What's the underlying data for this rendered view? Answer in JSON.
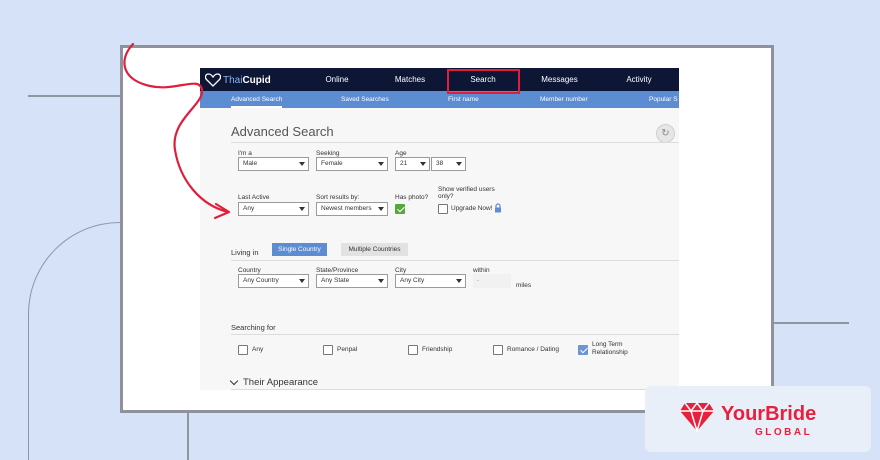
{
  "brand": {
    "logo_part1": "Thai",
    "logo_part2": "Cupid",
    "accent_color": "#5c8cd2",
    "nav_color": "#0d1735"
  },
  "nav": {
    "items": [
      "Online",
      "Matches",
      "Search",
      "Messages",
      "Activity"
    ]
  },
  "subnav": {
    "items": [
      "Advanced Search",
      "Saved Searches",
      "First name",
      "Member number",
      "Popular S"
    ]
  },
  "page": {
    "title": "Advanced Search",
    "reset_icon": "refresh-icon"
  },
  "form": {
    "im_a": {
      "label": "I'm a",
      "value": "Male"
    },
    "seeking": {
      "label": "Seeking",
      "value": "Female"
    },
    "age": {
      "label": "Age",
      "min": "21",
      "max": "38"
    },
    "last_active": {
      "label": "Last Active",
      "value": "Any"
    },
    "sort": {
      "label": "Sort results by:",
      "value": "Newest members"
    },
    "has_photo": {
      "label": "Has photo?",
      "checked": true
    },
    "verified": {
      "label_line1": "Show verified users",
      "label_line2": "only?",
      "upgrade": "Upgrade Now!",
      "checked": false
    },
    "living_in": {
      "label": "Living in",
      "single": "Single Country",
      "multiple": "Multiple Countries"
    },
    "country": {
      "label": "Country",
      "value": "Any Country"
    },
    "state": {
      "label": "State/Province",
      "value": "Any State"
    },
    "city": {
      "label": "City",
      "value": "Any City"
    },
    "within": {
      "label": "within",
      "value": "-",
      "unit": "miles"
    },
    "searching_for": {
      "label": "Searching for",
      "options": [
        {
          "label": "Any",
          "checked": false
        },
        {
          "label": "Penpal",
          "checked": false
        },
        {
          "label": "Friendship",
          "checked": false
        },
        {
          "label": "Romance / Dating",
          "checked": false
        },
        {
          "label_line1": "Long Term",
          "label_line2": "Relationship",
          "checked": true
        }
      ]
    },
    "appearance": {
      "label": "Their Appearance"
    }
  },
  "badge": {
    "name": "YourBride",
    "sub": "GLOBAL",
    "color": "#e8203e"
  }
}
